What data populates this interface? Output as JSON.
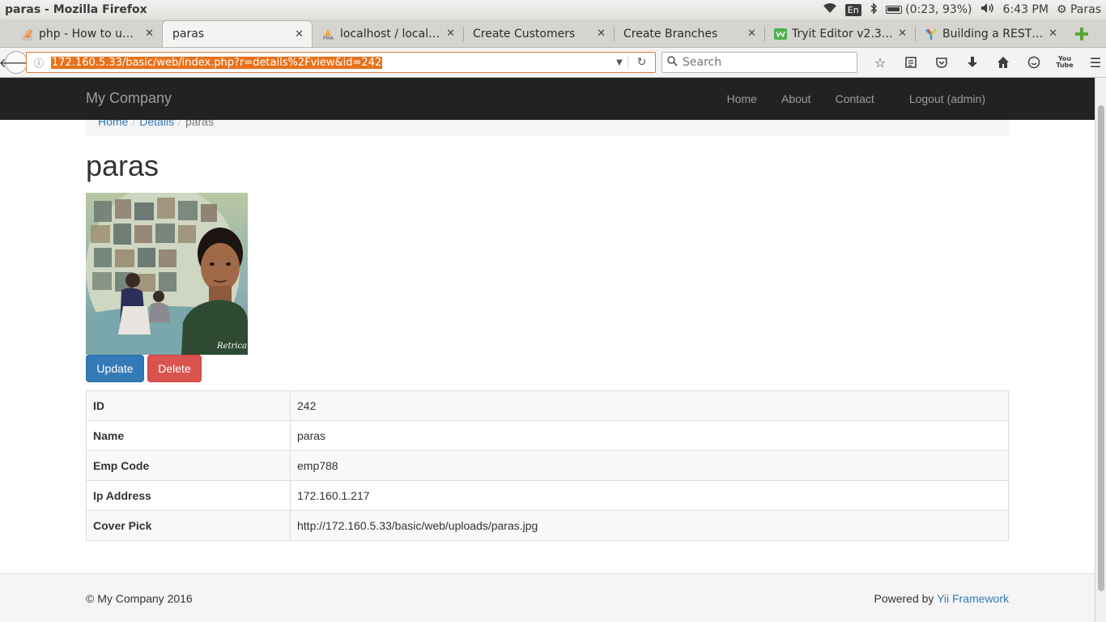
{
  "os": {
    "window_title": "paras - Mozilla Firefox",
    "lang": "En",
    "battery": "(0:23, 93%)",
    "clock": "6:43 PM",
    "user": "Paras"
  },
  "tabs": [
    {
      "label": "php - How to upl…",
      "icon": "stackoverflow-icon"
    },
    {
      "label": "paras",
      "icon": ""
    },
    {
      "label": "localhost / local…",
      "icon": "phpmyadmin-icon"
    },
    {
      "label": "Create Customers",
      "icon": ""
    },
    {
      "label": "Create Branches",
      "icon": ""
    },
    {
      "label": "Tryit Editor v2.3 …",
      "icon": "w3schools-icon"
    },
    {
      "label": "Building a REST …",
      "icon": "yii-icon"
    }
  ],
  "nav": {
    "url": "172.160.5.33/basic/web/index.php?r=details%2Fview&id=242",
    "search_placeholder": "Search",
    "youtube_label": "You Tube"
  },
  "site": {
    "brand": "My Company",
    "links": [
      "Home",
      "About",
      "Contact",
      "Logout (admin)"
    ]
  },
  "breadcrumb": {
    "home": "Home",
    "details": "Details",
    "current": "paras"
  },
  "page_title": "paras",
  "photo": {
    "watermark": "Retrica"
  },
  "buttons": {
    "update": "Update",
    "delete": "Delete"
  },
  "details": [
    {
      "label": "ID",
      "value": "242"
    },
    {
      "label": "Name",
      "value": "paras"
    },
    {
      "label": "Emp Code",
      "value": "emp788"
    },
    {
      "label": "Ip Address",
      "value": "172.160.1.217"
    },
    {
      "label": "Cover Pick",
      "value": "http://172.160.5.33/basic/web/uploads/paras.jpg"
    }
  ],
  "footer": {
    "copyright": "© My Company 2016",
    "powered_prefix": "Powered by",
    "powered_link": "Yii Framework"
  },
  "colors": {
    "primary": "#337ab7",
    "danger": "#d9534f",
    "url_highlight": "#e8711b",
    "navbar": "#222222"
  }
}
